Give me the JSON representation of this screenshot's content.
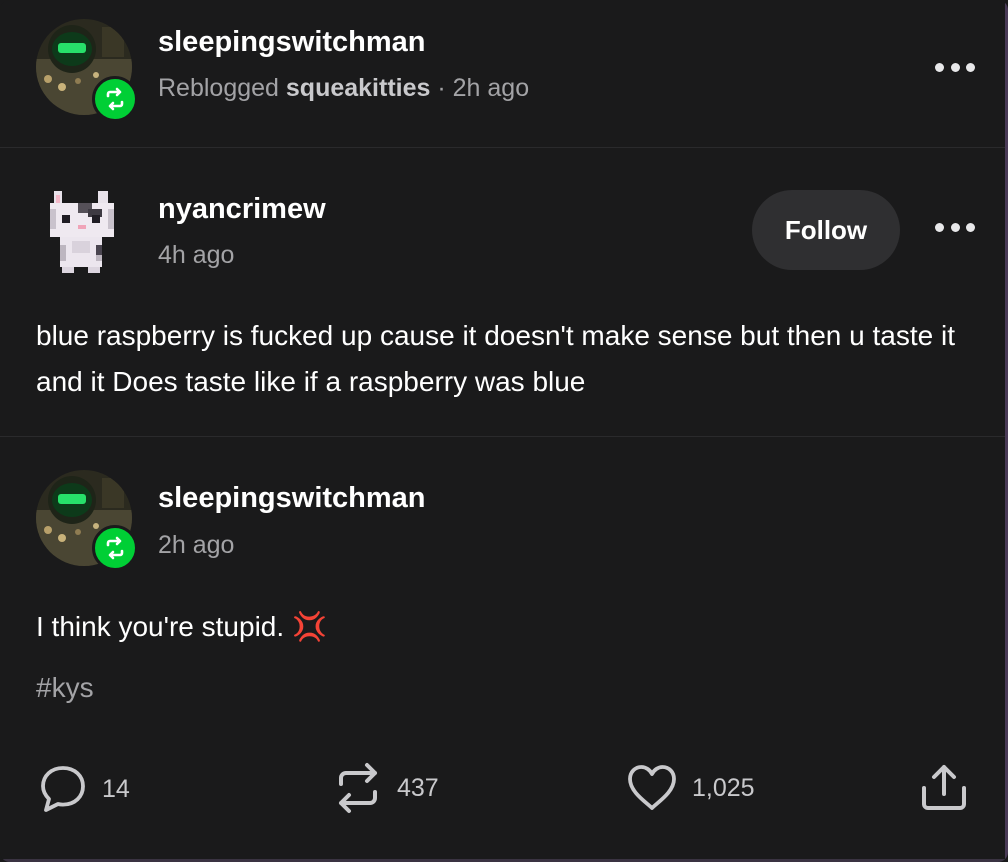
{
  "reblog_header": {
    "username": "sleepingswitchman",
    "reblogged_label": "Reblogged",
    "reblogged_from": "squeakitties",
    "separator": "·",
    "time": "2h ago"
  },
  "original_post": {
    "username": "nyancrimew",
    "time": "4h ago",
    "follow_label": "Follow",
    "body": "blue raspberry is fucked up cause it doesn't make sense but then u taste it and it Does taste like if a raspberry was blue"
  },
  "reblog_comment": {
    "username": "sleepingswitchman",
    "time": "2h ago",
    "body": "I think you're stupid.",
    "emoji": "💢",
    "tag": "#kys"
  },
  "actions": {
    "replies": "14",
    "reblogs": "437",
    "likes": "1,025"
  },
  "colors": {
    "background": "#1a1a1b",
    "reblog_green": "#00cf35",
    "muted_text": "#a3a3a6",
    "follow_button_bg": "#2f2f31"
  },
  "icons": {
    "reply": "speech-bubble-icon",
    "reblog": "reblog-arrows-icon",
    "like": "heart-icon",
    "share": "share-upload-icon",
    "more": "ellipsis-icon"
  }
}
